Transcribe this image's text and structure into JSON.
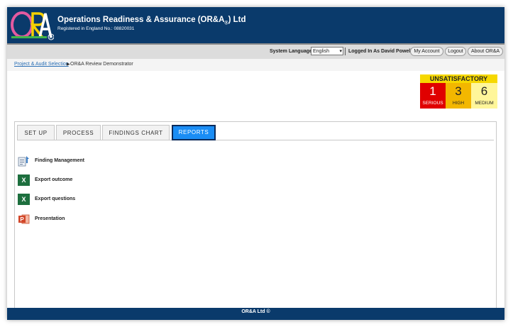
{
  "header": {
    "company_name_main": "Operations Readiness & Assurance (OR&A",
    "company_name_mark": "®",
    "company_name_tail": ") Ltd",
    "registration": "Registered in England No.: 08820031",
    "logo_text": "ORA",
    "logo_mark": "®"
  },
  "topbar": {
    "language_label": "System Language",
    "language_value": "English",
    "logged_in_label": "Logged In As David Powell",
    "my_account": "My Account",
    "logout": "Logout",
    "about": "About OR&A"
  },
  "breadcrumb": {
    "link": "Project & Audit Selection",
    "current": "OR&A Review Demonstrator"
  },
  "status": {
    "title": "UNSATISFACTORY",
    "cells": [
      {
        "value": "1",
        "label": "SERIOUS",
        "bg": "#e00000",
        "fg": "#ffffff"
      },
      {
        "value": "3",
        "label": "HIGH",
        "bg": "#f3b700",
        "fg": "#222222"
      },
      {
        "value": "6",
        "label": "MEDIUM",
        "bg": "#fff69a",
        "fg": "#222222"
      }
    ]
  },
  "tabs": [
    {
      "label": "SET UP"
    },
    {
      "label": "PROCESS"
    },
    {
      "label": "FINDINGS CHART"
    },
    {
      "label": "REPORTS",
      "active": true
    }
  ],
  "reports": [
    {
      "label": "Finding Management",
      "icon": "finding-management-icon"
    },
    {
      "label": "Export outcome",
      "icon": "excel-icon"
    },
    {
      "label": "Export questions",
      "icon": "excel-icon"
    },
    {
      "label": "Presentation",
      "icon": "powerpoint-icon"
    }
  ],
  "footer": {
    "text": "OR&A Ltd ©"
  },
  "colors": {
    "brand": "#0a3a6b",
    "accent": "#1a8df5"
  }
}
